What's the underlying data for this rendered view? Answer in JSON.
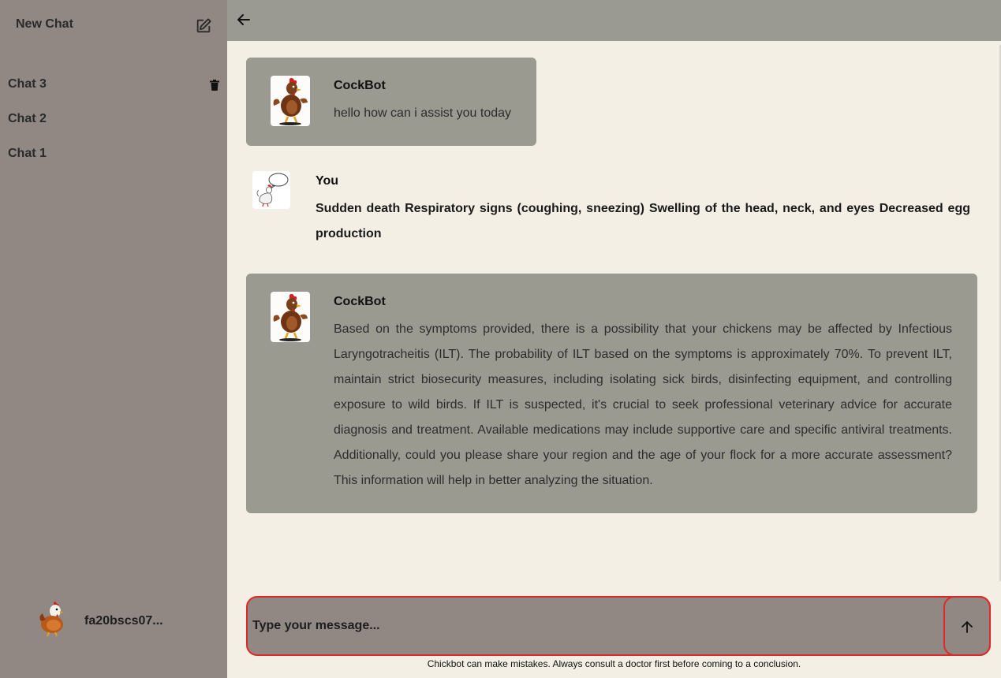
{
  "sidebar": {
    "new_chat_label": "New Chat",
    "chats": [
      {
        "label": "Chat 3"
      },
      {
        "label": "Chat 2"
      },
      {
        "label": "Chat 1"
      }
    ],
    "user_name": "fa20bscs07..."
  },
  "messages": [
    {
      "sender": "CockBot",
      "text": "hello how can i assist you today"
    },
    {
      "sender": "You",
      "text": "Sudden death Respiratory signs (coughing, sneezing) Swelling of the head, neck, and eyes Decreased egg production"
    },
    {
      "sender": "CockBot",
      "text": "Based on the symptoms provided, there is a possibility that your chickens may be affected by Infectious Laryngotracheitis (ILT). The probability of ILT based on the symptoms is approximately 70%. To prevent ILT, maintain strict biosecurity measures, including isolating sick birds, disinfecting equipment, and controlling exposure to wild birds. If ILT is suspected, it's crucial to seek professional veterinary advice for accurate diagnosis and treatment. Available medications may include supportive care and specific antiviral treatments. Additionally, could you please share your region and the age of your flock for a more accurate assessment? This information will help in better analyzing the situation."
    }
  ],
  "composer": {
    "placeholder": "Type your message..."
  },
  "disclaimer": "Chickbot can make mistakes. Always consult a doctor first before coming to a conclusion.",
  "icons": {
    "edit": "edit-icon",
    "trash": "trash-icon",
    "back": "arrow-left-icon",
    "send": "arrow-up-icon"
  },
  "colors": {
    "sidebar_bg": "#918884",
    "topbar_bg": "#9a9a92",
    "main_bg": "#f3efe5",
    "bot_bubble": "#9a9a91",
    "input_border": "#e02828"
  }
}
